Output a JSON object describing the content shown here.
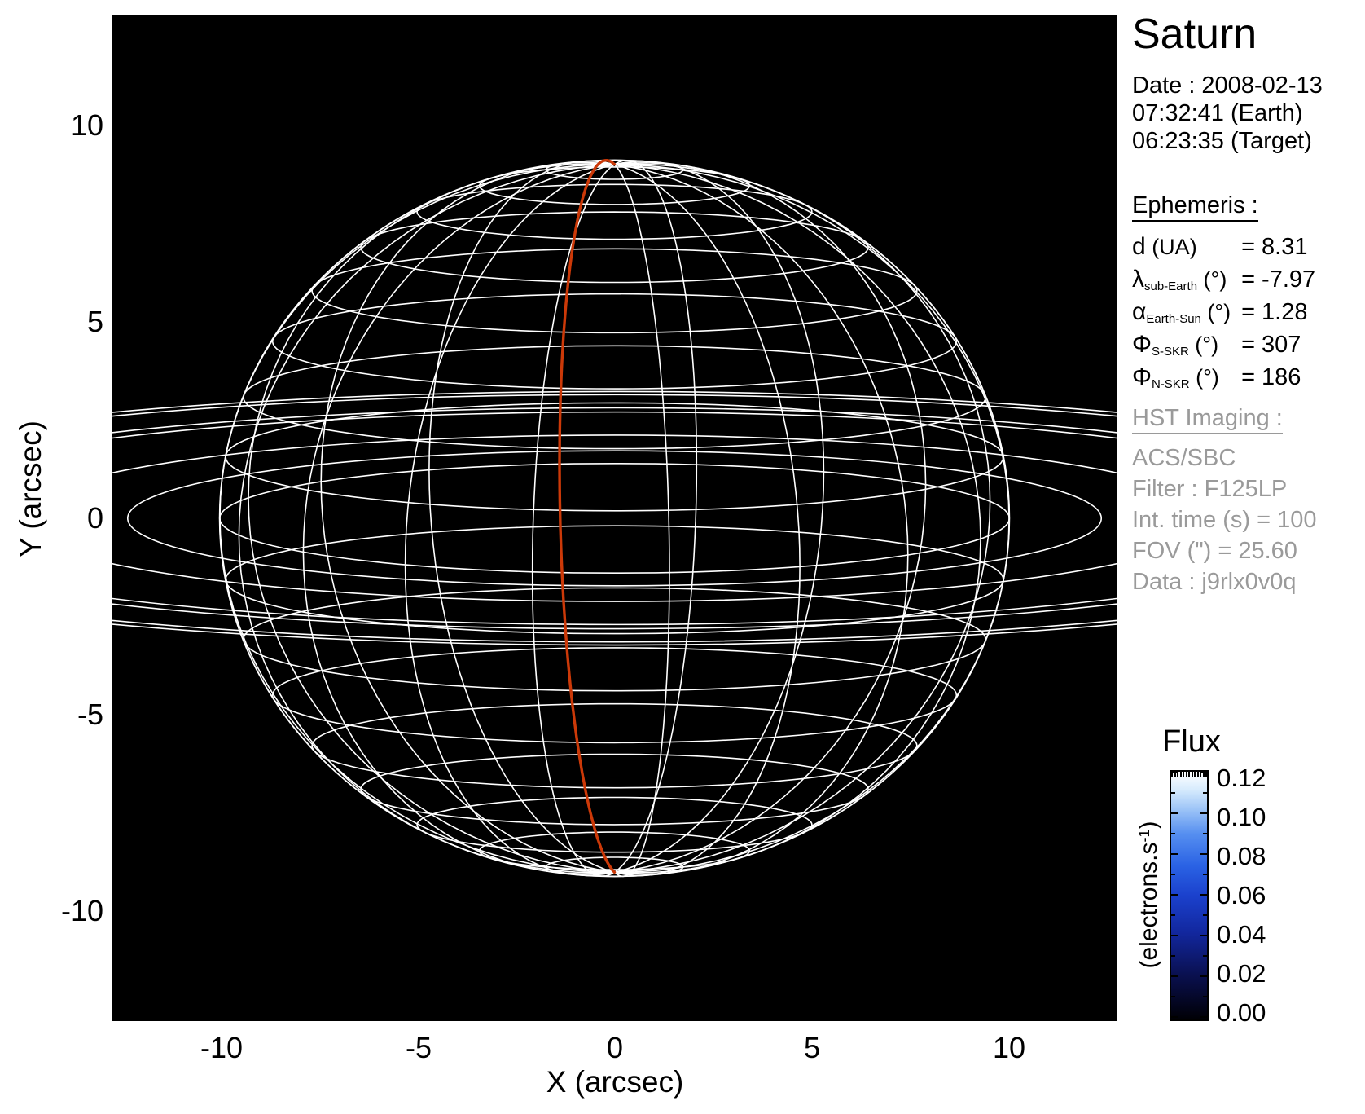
{
  "title": "Saturn",
  "datetime": {
    "date_line": "Date : 2008-02-13",
    "earth_line": "07:32:41 (Earth)",
    "target_line": "06:23:35 (Target)"
  },
  "ephemeris": {
    "heading": "Ephemeris :",
    "rows": [
      {
        "sym": "d",
        "sub": "",
        "unit": " (UA)",
        "value": "= 8.31"
      },
      {
        "sym": "λ",
        "sub": "sub-Earth",
        "unit": " (°)",
        "value": "= -7.97"
      },
      {
        "sym": "α",
        "sub": "Earth-Sun",
        "unit": " (°)",
        "value": "= 1.28"
      },
      {
        "sym": "Φ",
        "sub": "S-SKR",
        "unit": " (°)",
        "value": "= 307"
      },
      {
        "sym": "Φ",
        "sub": "N-SKR",
        "unit": " (°)",
        "value": "= 186"
      }
    ]
  },
  "hst": {
    "heading": "HST Imaging :",
    "lines": [
      "ACS/SBC",
      "Filter : F125LP",
      "Int. time (s) = 100",
      "FOV (\") = 25.60",
      "Data : j9rlx0v0q"
    ]
  },
  "axes": {
    "xlabel": "X (arcsec)",
    "ylabel": "Y (arcsec)",
    "x_ticks": [
      "-10",
      "-5",
      "0",
      "5",
      "10"
    ],
    "y_ticks": [
      "10",
      "5",
      "0",
      "-5",
      "-10"
    ]
  },
  "colorbar": {
    "title": "Flux",
    "unit_prefix": "(electrons.s",
    "unit_exp": "-1",
    "unit_suffix": ")",
    "tick_labels": [
      "0.12",
      "0.10",
      "0.08",
      "0.06",
      "0.04",
      "0.02",
      "0.00"
    ],
    "min": 0.0,
    "max": 0.12,
    "step": 0.02
  },
  "colors": {
    "page_background": "#ffffff",
    "plot_background": "#000000",
    "wireframe": "#ffffff",
    "central_meridian_red": "#cc3908",
    "secondary_text_gray": "#9a9a9a",
    "colorbar_bottom": "#000005",
    "colorbar_mid_blue": "#1b41cd",
    "colorbar_top": "#ffffff"
  },
  "chart_data": {
    "type": "wireframe_planet_projection",
    "target": "Saturn",
    "title": "Saturn",
    "xlabel": "X (arcsec)",
    "ylabel": "Y (arcsec)",
    "x_range_arcsec": [
      -12.8,
      12.8
    ],
    "y_range_arcsec": [
      -12.8,
      12.8
    ],
    "fov_arcsec": 25.6,
    "grid": false,
    "planet": {
      "equatorial_radius_arcsec": 10.05,
      "polar_radius_arcsec": 9.09,
      "sub_earth_latitude_deg": -7.97,
      "latitude_grid_step_deg": 10,
      "longitude_grid_step_deg": 20
    },
    "rings_radii_arcsec": [
      12.39,
      15.26,
      19.5,
      20.27,
      22.69,
      23.26
    ],
    "ring_flattening": 0.1386,
    "central_meridian_longitude_deg": -8,
    "ephemeris_values": {
      "d_UA": 8.31,
      "lambda_sub_earth_deg": -7.97,
      "alpha_earth_sun_deg": 1.28,
      "phi_s_skr_deg": 307,
      "phi_n_skr_deg": 186
    },
    "colorbar": {
      "min": 0.0,
      "max": 0.12,
      "step": 0.02,
      "unit": "electrons/s"
    }
  }
}
